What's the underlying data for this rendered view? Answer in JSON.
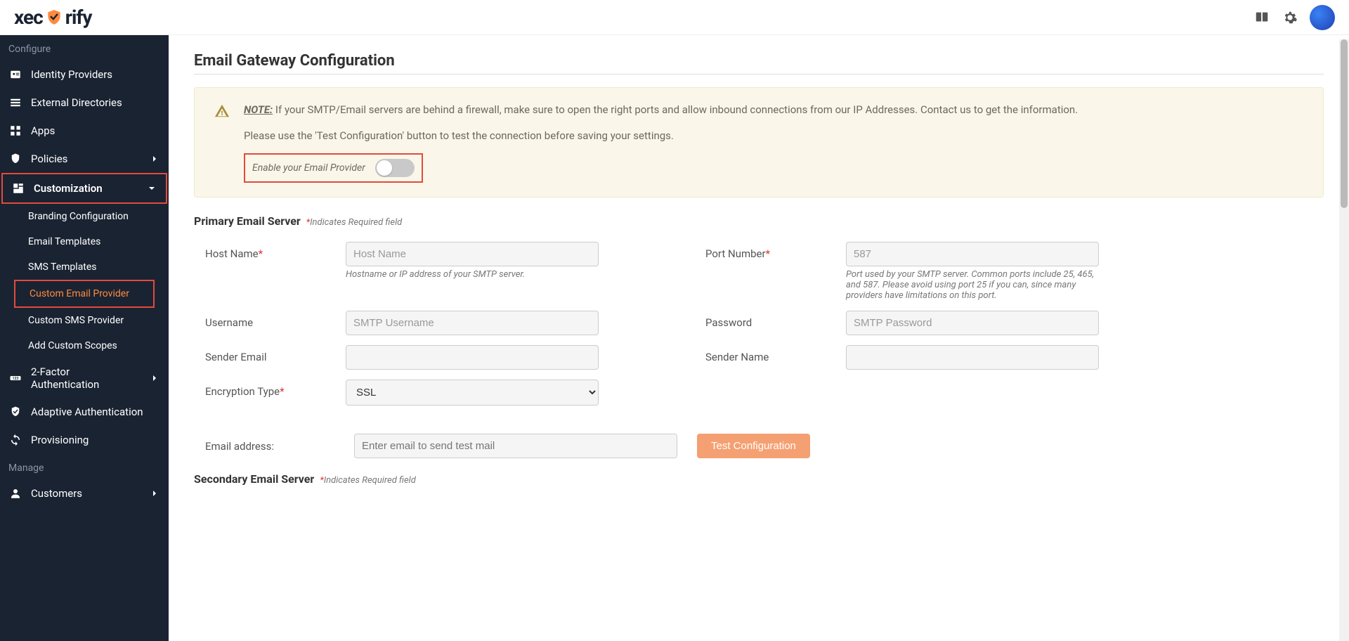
{
  "logo_parts": {
    "pre": "xec",
    "post": "rify"
  },
  "sidebar": {
    "section_configure": "Configure",
    "section_manage": "Manage",
    "items": {
      "identity_providers": "Identity Providers",
      "external_directories": "External Directories",
      "apps": "Apps",
      "policies": "Policies",
      "customization": "Customization",
      "two_factor": "2-Factor Authentication",
      "adaptive_auth": "Adaptive Authentication",
      "provisioning": "Provisioning",
      "customers": "Customers"
    },
    "sub": {
      "branding": "Branding Configuration",
      "email_templates": "Email Templates",
      "sms_templates": "SMS Templates",
      "custom_email": "Custom Email Provider",
      "custom_sms": "Custom SMS Provider",
      "add_scopes": "Add Custom Scopes"
    }
  },
  "page": {
    "title": "Email Gateway Configuration",
    "note_label": "NOTE:",
    "note_text1": " If your SMTP/Email servers are behind a firewall, make sure to open the right ports and allow inbound connections from our IP Addresses. Contact us to get the information.",
    "note_text2": "Please use the 'Test Configuration' button to test the connection before saving your settings.",
    "toggle_label": "Enable your Email Provider",
    "primary_server": "Primary Email Server",
    "secondary_server": "Secondary Email Server",
    "req_note": "Indicates Required field"
  },
  "form": {
    "host_label": "Host Name",
    "host_placeholder": "Host Name",
    "host_help": "Hostname or IP address of your SMTP server.",
    "port_label": "Port Number",
    "port_placeholder": "587",
    "port_help": "Port used by your SMTP server. Common ports include 25, 465, and 587. Please avoid using port 25 if you can, since many providers have limitations on this port.",
    "user_label": "Username",
    "user_placeholder": "SMTP Username",
    "pass_label": "Password",
    "pass_placeholder": "SMTP Password",
    "sender_email_label": "Sender Email",
    "sender_name_label": "Sender Name",
    "encryption_label": "Encryption Type",
    "encryption_value": "SSL",
    "test_label": "Email address:",
    "test_placeholder": "Enter email to send test mail",
    "test_button": "Test Configuration"
  }
}
